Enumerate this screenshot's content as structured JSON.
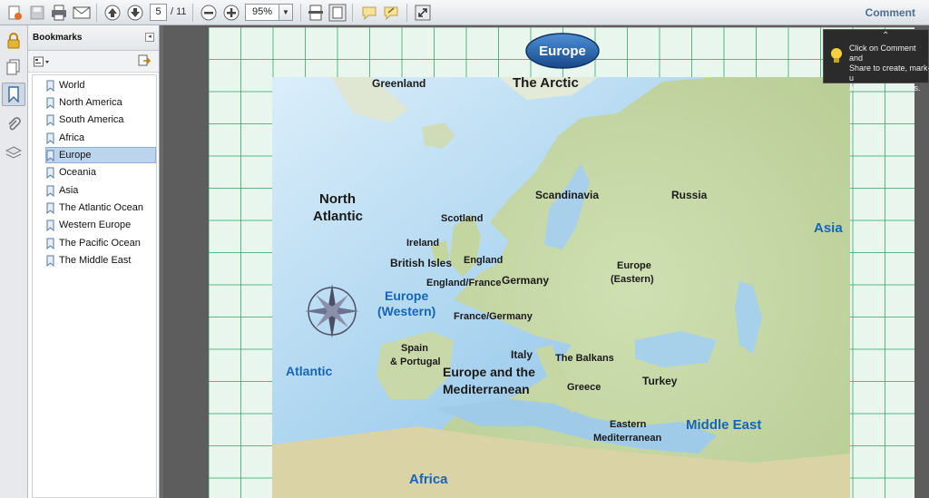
{
  "toolbar": {
    "page_current": "5",
    "page_total": "/ 11",
    "zoom": "95%",
    "comment_label": "Comment",
    "buttons": [
      "create-pdf",
      "save",
      "print",
      "email",
      "previous-page",
      "next-page",
      "zoom-out",
      "zoom-in",
      "fit-page-width",
      "fit-page",
      "sticky-note",
      "highlight",
      "full-screen"
    ]
  },
  "left_strip": {
    "icons": [
      "lock-icon",
      "pages-icon",
      "bookmark-icon",
      "attachment-icon",
      "layers-icon"
    ],
    "active": "bookmark-icon"
  },
  "bookmarks": {
    "title": "Bookmarks",
    "items": [
      "World",
      "North America",
      "South America",
      "Africa",
      "Europe",
      "Oceania",
      "Asia",
      "The Atlantic Ocean",
      "Western Europe",
      "The Pacific Ocean",
      "The Middle East"
    ],
    "selected_index": 4
  },
  "map": {
    "banner": "Europe",
    "labels": {
      "greenland": "Greenland",
      "arctic": "The Arctic",
      "north_atlantic_1": "North",
      "north_atlantic_2": "Atlantic",
      "scotland": "Scotland",
      "ireland": "Ireland",
      "british_isles": "British Isles",
      "england": "England",
      "england_france": "England/France",
      "germany": "Germany",
      "scandinavia": "Scandinavia",
      "russia": "Russia",
      "europe_eastern_1": "Europe",
      "europe_eastern_2": "(Eastern)",
      "asia": "Asia",
      "europe_western_1": "Europe",
      "europe_western_2": "(Western)",
      "france_germany": "France/Germany",
      "spain_portugal_1": "Spain",
      "spain_portugal_2": "& Portugal",
      "italy": "Italy",
      "balkans": "The Balkans",
      "atlantic": "Atlantic",
      "europe_med_1": "Europe and the",
      "europe_med_2": "Mediterranean",
      "greece": "Greece",
      "turkey": "Turkey",
      "eastern_med_1": "Eastern",
      "eastern_med_2": "Mediterranean",
      "middle_east": "Middle East",
      "africa": "Africa"
    }
  },
  "tooltip": {
    "text_line1": "Click on Comment and",
    "text_line2": "Share to create, mark-u",
    "text_line3": "and send PDF files."
  },
  "colors": {
    "region_link": "#1565b8",
    "label_dark": "#1a1a1a",
    "banner": "#1f5fa8",
    "grid_line": "#34a86a"
  }
}
